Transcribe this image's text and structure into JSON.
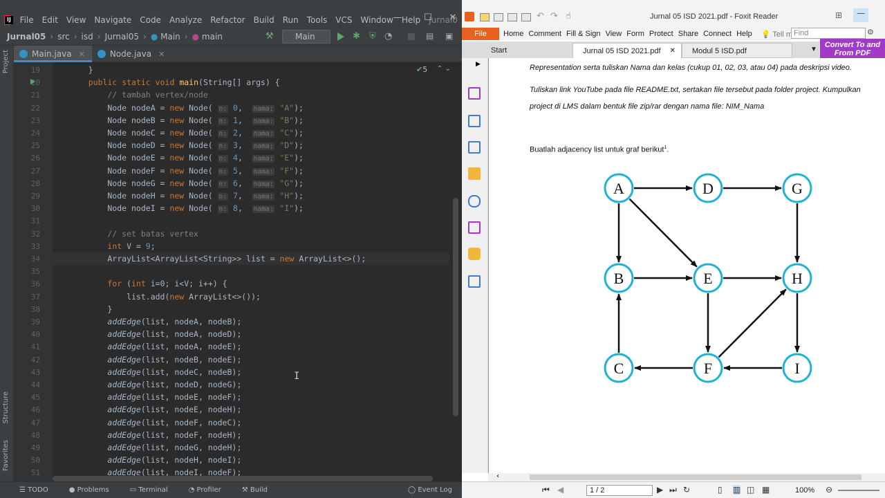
{
  "ide": {
    "menu": [
      "File",
      "Edit",
      "View",
      "Navigate",
      "Code",
      "Analyze",
      "Refactor",
      "Build",
      "Run",
      "Tools",
      "VCS",
      "Window",
      "Help",
      "Jurnal0"
    ],
    "breadcrumbs": [
      "Jurnal05",
      "src",
      "isd",
      "Jurnal05",
      "Main",
      "main"
    ],
    "run_config": "Main",
    "tabs": [
      {
        "label": "Main.java",
        "active": true
      },
      {
        "label": "Node.java",
        "active": false
      }
    ],
    "problems_count": "5",
    "left_labels": [
      "Project",
      "Structure",
      "Favorites"
    ],
    "status": [
      "TODO",
      "Problems",
      "Terminal",
      "Profiler",
      "Build",
      "Event Log"
    ],
    "lines": [
      {
        "n": "19",
        "t": "    }"
      },
      {
        "n": "20",
        "t": "    public static void main(String[] args) {"
      },
      {
        "n": "21",
        "t": "        // tambah vertex/node"
      },
      {
        "n": "22",
        "t": "        Node nodeA = new Node( n: 0,  nama: \"A\");"
      },
      {
        "n": "23",
        "t": "        Node nodeB = new Node( n: 1,  nama: \"B\");"
      },
      {
        "n": "24",
        "t": "        Node nodeC = new Node( n: 2,  nama: \"C\");"
      },
      {
        "n": "25",
        "t": "        Node nodeD = new Node( n: 3,  nama: \"D\");"
      },
      {
        "n": "26",
        "t": "        Node nodeE = new Node( n: 4,  nama: \"E\");"
      },
      {
        "n": "27",
        "t": "        Node nodeF = new Node( n: 5,  nama: \"F\");"
      },
      {
        "n": "28",
        "t": "        Node nodeG = new Node( n: 6,  nama: \"G\");"
      },
      {
        "n": "29",
        "t": "        Node nodeH = new Node( n: 7,  nama: \"H\");"
      },
      {
        "n": "30",
        "t": "        Node nodeI = new Node( n: 8,  nama: \"I\");"
      },
      {
        "n": "31",
        "t": ""
      },
      {
        "n": "32",
        "t": "        // set batas vertex"
      },
      {
        "n": "33",
        "t": "        int V = 9;"
      },
      {
        "n": "34",
        "t": "        ArrayList<ArrayList<String>> list = new ArrayList<>();"
      },
      {
        "n": "35",
        "t": ""
      },
      {
        "n": "36",
        "t": "        for (int i=0; i<V; i++) {"
      },
      {
        "n": "37",
        "t": "            list.add(new ArrayList<>());"
      },
      {
        "n": "38",
        "t": "        }"
      },
      {
        "n": "39",
        "t": "        addEdge(list, nodeA, nodeB);"
      },
      {
        "n": "40",
        "t": "        addEdge(list, nodeA, nodeD);"
      },
      {
        "n": "41",
        "t": "        addEdge(list, nodeA, nodeE);"
      },
      {
        "n": "42",
        "t": "        addEdge(list, nodeB, nodeE);"
      },
      {
        "n": "43",
        "t": "        addEdge(list, nodeC, nodeB);"
      },
      {
        "n": "44",
        "t": "        addEdge(list, nodeD, nodeG);"
      },
      {
        "n": "45",
        "t": "        addEdge(list, nodeE, nodeF);"
      },
      {
        "n": "46",
        "t": "        addEdge(list, nodeE, nodeH);"
      },
      {
        "n": "47",
        "t": "        addEdge(list, nodeF, nodeC);"
      },
      {
        "n": "48",
        "t": "        addEdge(list, nodeF, nodeH);"
      },
      {
        "n": "49",
        "t": "        addEdge(list, nodeG, nodeH);"
      },
      {
        "n": "50",
        "t": "        addEdge(list, nodeH, nodeI);"
      },
      {
        "n": "51",
        "t": "        addEdge(list, nodeI, nodeF);"
      }
    ]
  },
  "foxit": {
    "title": "Jurnal 05 ISD 2021.pdf - Foxit Reader",
    "ribbon": [
      "File",
      "Home",
      "Comment",
      "Fill & Sign",
      "View",
      "Form",
      "Protect",
      "Share",
      "Connect",
      "Help",
      "Tell me..."
    ],
    "find_placeholder": "Find",
    "tabs": [
      "Start",
      "Jurnal 05 ISD 2021.pdf",
      "Modul 5 ISD.pdf"
    ],
    "convert": "Convert To and From PDF",
    "doc": {
      "line1": "Representation serta tuliskan Nama dan kelas (cukup 01, 02, 03, atau 04) pada deskripsi video.",
      "line2": "Tuliskan link YouTube pada file README.txt, sertakan file tersebut pada folder project. Kumpulkan",
      "line3": "project di LMS dalam bentuk file zip/rar dengan nama file: NIM_Nama",
      "task": "Buatlah adjacency list untuk graf berikut",
      "footnote": "1",
      "graph_color": "#1fb2d6",
      "nodes": [
        "A",
        "D",
        "G",
        "B",
        "E",
        "H",
        "C",
        "F",
        "I"
      ],
      "edges": [
        [
          "A",
          "B"
        ],
        [
          "A",
          "D"
        ],
        [
          "A",
          "E"
        ],
        [
          "B",
          "E"
        ],
        [
          "C",
          "B"
        ],
        [
          "D",
          "G"
        ],
        [
          "E",
          "F"
        ],
        [
          "E",
          "H"
        ],
        [
          "F",
          "C"
        ],
        [
          "F",
          "H"
        ],
        [
          "G",
          "H"
        ],
        [
          "H",
          "I"
        ],
        [
          "I",
          "F"
        ]
      ]
    },
    "page": "1 / 2",
    "zoom": "100%"
  }
}
